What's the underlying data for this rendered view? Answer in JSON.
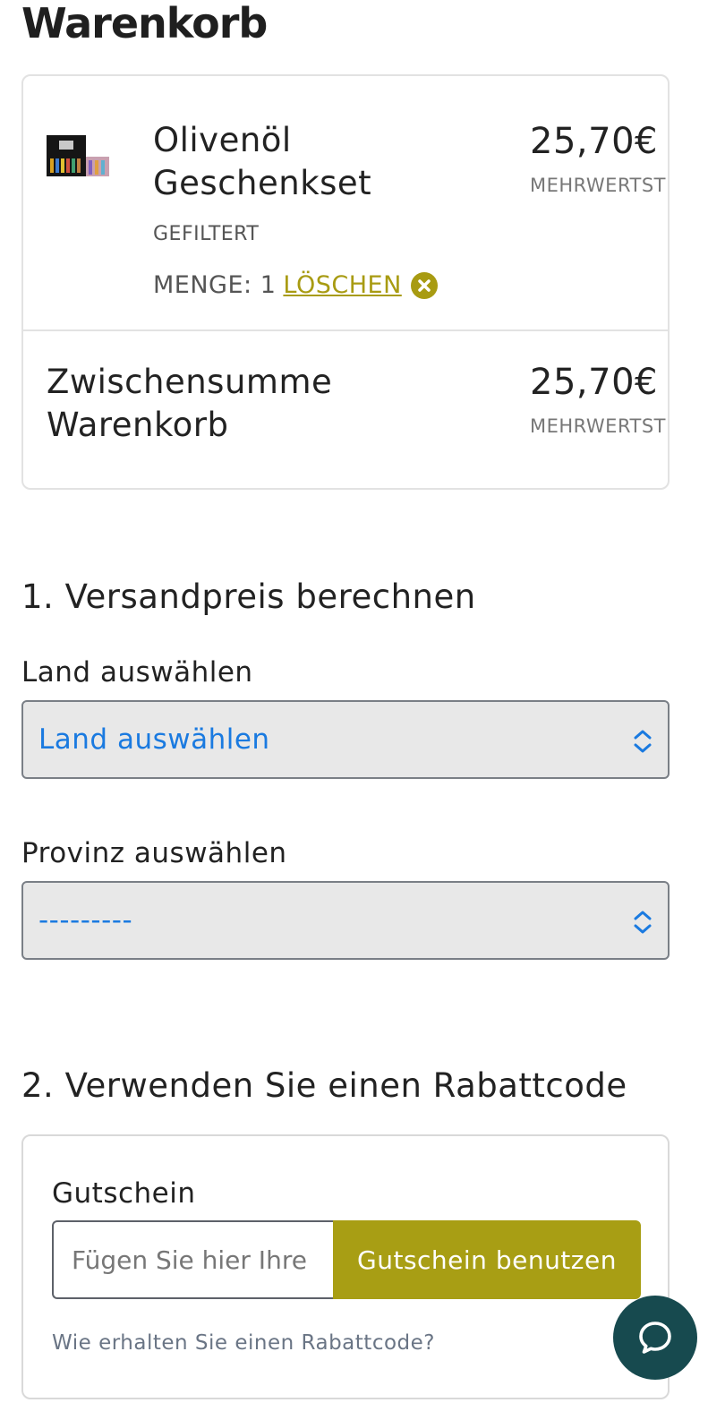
{
  "page": {
    "title": "Warenkorb"
  },
  "cart": {
    "item": {
      "name": "Olivenöl Geschenkset",
      "variant": "GEFILTERT",
      "quantity_label": "MENGE: 1",
      "delete_label": "LÖSCHEN",
      "price": "25,70€",
      "tax_note": "MEHRWERTSTEUER INBEGRIFFEN",
      "thumbnail_icon": "product-image"
    },
    "subtotal": {
      "label": "Zwischensumme Warenkorb",
      "price": "25,70€",
      "tax_note": "MEHRWERTSTEUER INBEGRIFFEN"
    }
  },
  "shipping": {
    "section_title": "1. Versandpreis berechnen",
    "country_label": "Land auswählen",
    "country_value": "Land auswählen",
    "province_label": "Provinz auswählen",
    "province_value": "---------"
  },
  "coupon": {
    "section_title": "2. Verwenden Sie einen Rabattcode",
    "label": "Gutschein",
    "input_placeholder": "Fügen Sie hier Ihre",
    "button_label": "Gutschein benutzen",
    "help_link": "Wie erhalten Sie einen Rabattcode?"
  },
  "chat": {
    "icon": "chat-bubble-icon"
  },
  "colors": {
    "accent": "#a89b12",
    "select_text": "#1a7ae0",
    "chat_bg": "#174a4f"
  }
}
